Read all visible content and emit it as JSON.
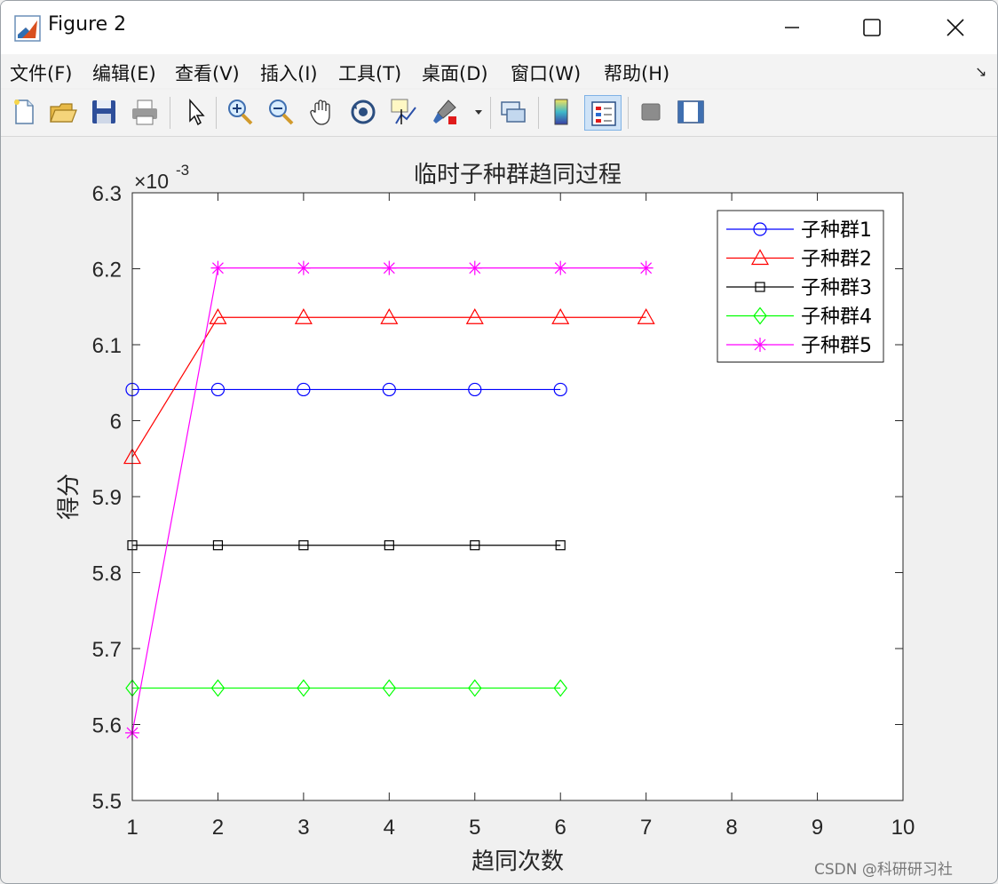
{
  "window": {
    "title": "Figure 2"
  },
  "menu": {
    "items": [
      "文件(F)",
      "编辑(E)",
      "查看(V)",
      "插入(I)",
      "工具(T)",
      "桌面(D)",
      "窗口(W)",
      "帮助(H)"
    ]
  },
  "toolbar": {
    "icons": [
      "new-figure-icon",
      "open-file-icon",
      "save-icon",
      "print-icon",
      "select-arrow-icon",
      "zoom-in-icon",
      "zoom-out-icon",
      "pan-hand-icon",
      "rotate-3d-icon",
      "data-cursor-icon",
      "brush-icon",
      "link-plot-icon",
      "colorbar-icon",
      "legend-icon",
      "hide-plot-tools-icon",
      "show-plot-tools-icon"
    ]
  },
  "watermark": "CSDN @科研研习社",
  "chart_data": {
    "type": "line",
    "title": "临时子种群趋同过程",
    "xlabel": "趋同次数",
    "ylabel": "得分",
    "exponent_label": "×10",
    "exponent_power": "-3",
    "xlim": [
      1,
      10
    ],
    "ylim": [
      5.5,
      6.3
    ],
    "xticks": [
      "1",
      "2",
      "3",
      "4",
      "5",
      "6",
      "7",
      "8",
      "9",
      "10"
    ],
    "yticks": [
      "5.5",
      "5.6",
      "5.7",
      "5.8",
      "5.9",
      "6",
      "6.1",
      "6.2",
      "6.3"
    ],
    "legend_position": "top-right",
    "grid": false,
    "series": [
      {
        "name": "子种群1",
        "color": "#0000ff",
        "marker": "circle",
        "x": [
          1,
          2,
          3,
          4,
          5,
          6
        ],
        "y": [
          6.041,
          6.041,
          6.041,
          6.041,
          6.041,
          6.041
        ]
      },
      {
        "name": "子种群2",
        "color": "#ff0000",
        "marker": "triangle",
        "x": [
          1,
          2,
          3,
          4,
          5,
          6,
          7
        ],
        "y": [
          5.952,
          6.136,
          6.136,
          6.136,
          6.136,
          6.136,
          6.136
        ]
      },
      {
        "name": "子种群3",
        "color": "#000000",
        "marker": "square",
        "x": [
          1,
          2,
          3,
          4,
          5,
          6
        ],
        "y": [
          5.836,
          5.836,
          5.836,
          5.836,
          5.836,
          5.836
        ]
      },
      {
        "name": "子种群4",
        "color": "#00ff00",
        "marker": "diamond",
        "x": [
          1,
          2,
          3,
          4,
          5,
          6
        ],
        "y": [
          5.648,
          5.648,
          5.648,
          5.648,
          5.648,
          5.648
        ]
      },
      {
        "name": "子种群5",
        "color": "#ff00ff",
        "marker": "star",
        "x": [
          1,
          2,
          3,
          4,
          5,
          6,
          7
        ],
        "y": [
          5.589,
          6.201,
          6.201,
          6.201,
          6.201,
          6.201,
          6.201
        ]
      }
    ]
  }
}
